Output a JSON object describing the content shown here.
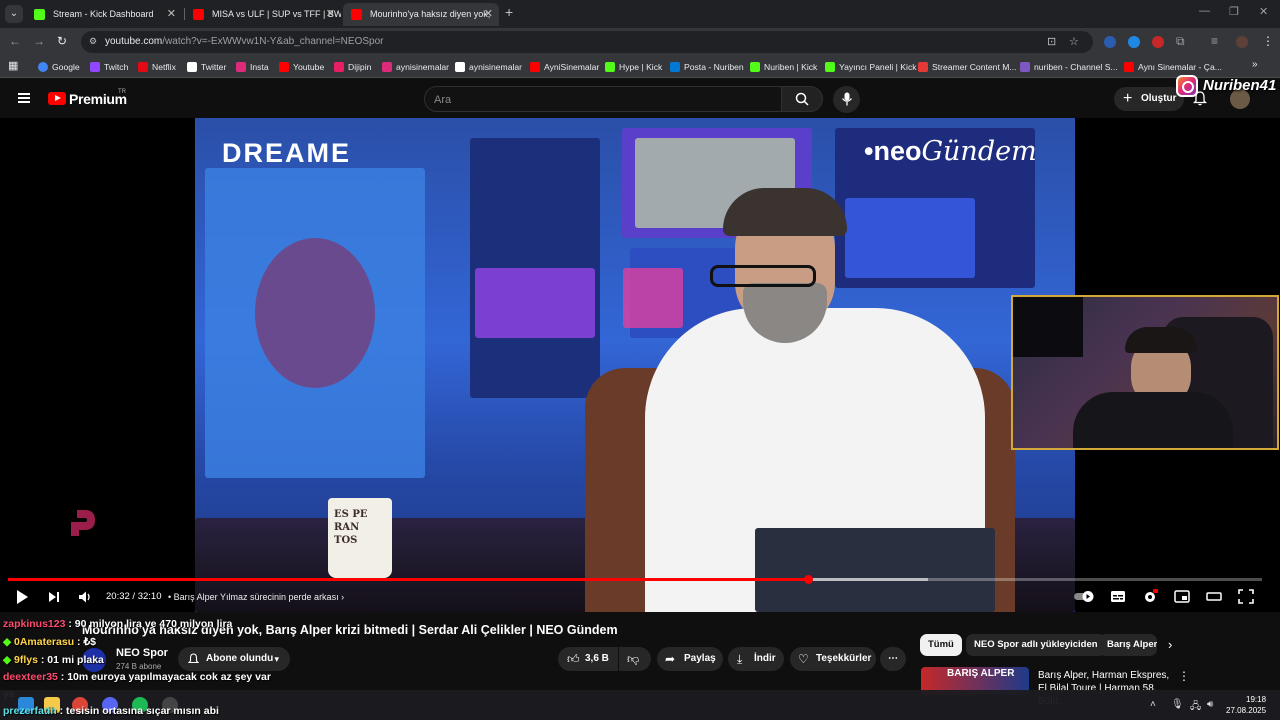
{
  "browser": {
    "tabs": [
      {
        "title": "Stream - Kick Dashboard",
        "active": false,
        "favicon_color": "#53fc18"
      },
      {
        "title": "MISA vs ULF | SUP vs TFF | BW",
        "active": false,
        "favicon_color": "#ff0000"
      },
      {
        "title": "Mourinho'ya haksız diyen yok,",
        "active": true,
        "favicon_color": "#ff0000"
      }
    ],
    "new_tab_label": "+",
    "url_host": "youtube.com",
    "url_rest": "/watch?v=-ExWWvw1N-Y&ab_channel=NEOSpor",
    "bookmarks": [
      {
        "label": "Google",
        "icon": "google-icon",
        "color": "#4285f4"
      },
      {
        "label": "Twitch",
        "icon": "twitch-icon",
        "color": "#9146ff"
      },
      {
        "label": "Netflix",
        "icon": "netflix-icon",
        "color": "#e50914"
      },
      {
        "label": "Twitter",
        "icon": "x-icon",
        "color": "#ffffff"
      },
      {
        "label": "Insta",
        "icon": "instagram-icon",
        "color": "#dd2a7b"
      },
      {
        "label": "Youtube",
        "icon": "youtube-icon",
        "color": "#ff0000"
      },
      {
        "label": "Dijipin",
        "icon": "dijipin-icon",
        "color": "#e91e63"
      },
      {
        "label": "aynisinemalar",
        "icon": "instagram-icon",
        "color": "#dd2a7b"
      },
      {
        "label": "aynisinemalar",
        "icon": "x-icon",
        "color": "#ffffff"
      },
      {
        "label": "AyniSinemalar",
        "icon": "youtube-icon",
        "color": "#ff0000"
      },
      {
        "label": "Hype | Kick",
        "icon": "kick-icon",
        "color": "#53fc18"
      },
      {
        "label": "Posta - Nuriben",
        "icon": "mail-icon",
        "color": "#0078d4"
      },
      {
        "label": "Nuriben | Kick",
        "icon": "kick-icon",
        "color": "#53fc18"
      },
      {
        "label": "Yayıncı Paneli | Kick",
        "icon": "kick-icon",
        "color": "#53fc18"
      },
      {
        "label": "Streamer Content M...",
        "icon": "streamer-icon",
        "color": "#e53935"
      },
      {
        "label": "nuriben - Channel S...",
        "icon": "channel-icon",
        "color": "#7e57c2"
      },
      {
        "label": "Aynı Sinemalar - Ça...",
        "icon": "youtube-icon",
        "color": "#ff0000"
      }
    ]
  },
  "youtube": {
    "logo_text": "Premium",
    "region": "TR",
    "search_placeholder": "Ara",
    "create_label": "Oluştur"
  },
  "overlay": {
    "instagram_name": "Nuriben41"
  },
  "video": {
    "brand_left": "DREAME",
    "brand_right_prefix": "•neo",
    "brand_right_suffix": "Gündem",
    "mug_text": "ES PE RAN TOS",
    "time_current": "20:32",
    "time_total": "32:10",
    "progress": 0.638,
    "chapter": "Barış Alper Yılmaz sürecinin perde arkası",
    "title": "Mourinho'ya haksız diyen yok, Barış Alper krizi bitmedi | Serdar Ali Çelikler | NEO Gündem"
  },
  "channel": {
    "name": "NEO Spor",
    "subscribers": "274 B abone",
    "subscribe_label": "Abone olundu"
  },
  "actions": {
    "likes": "3,6 B",
    "share": "Paylaş",
    "download": "İndir",
    "thanks": "Teşekkürler",
    "more": "⋯"
  },
  "chips": [
    "Tümü",
    "NEO Spor adlı yükleyiciden",
    "Barış Alper"
  ],
  "recommendation": {
    "title": "Barış Alper, Harman Ekspres, El Bilal Toure | Harman 58. Bölü...",
    "thumb_text": "BARIŞ ALPER"
  },
  "chat": [
    {
      "user": "zapkinus123",
      "color": "#ff4a6e",
      "message": ": 90 milyon lira ve 470 milyon lira"
    },
    {
      "user": "0Amaterasu",
      "color": "#ffd54a",
      "message": ": ₺$",
      "badge": true
    },
    {
      "user": "9flys",
      "color": "#ffd54a",
      "message": ": 01 mi plaka",
      "badge": true
    },
    {
      "user": "deexteer35",
      "color": "#ff4a6e",
      "message": ": 10m euroya yapılmayacak cok az şey var"
    },
    {
      "user": "",
      "color": "#ffffff",
      "message": "ya"
    },
    {
      "user": "prezerfatih",
      "color": "#5ce1e6",
      "message": ": tesisin ortasına sıçar mısın abi"
    }
  ],
  "taskbar": {
    "time": "19:18",
    "date": "27.08.2025"
  }
}
